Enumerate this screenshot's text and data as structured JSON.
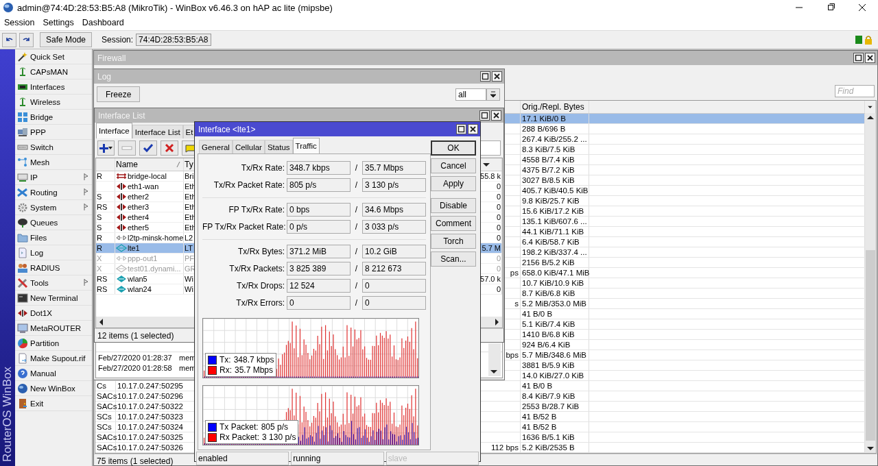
{
  "window": {
    "title": "admin@74:4D:28:53:B5:A8 (MikroTik) - WinBox v6.46.3 on hAP ac lite (mipsbe)"
  },
  "menu": [
    "Session",
    "Settings",
    "Dashboard"
  ],
  "toolbar": {
    "safe_mode": "Safe Mode",
    "session_label": "Session:",
    "session_value": "74:4D:28:53:B5:A8"
  },
  "sidebar": {
    "brand": "RouterOS WinBox",
    "items": [
      {
        "label": "Quick Set",
        "submenu": false
      },
      {
        "label": "CAPsMAN",
        "submenu": false
      },
      {
        "label": "Interfaces",
        "submenu": false
      },
      {
        "label": "Wireless",
        "submenu": false
      },
      {
        "label": "Bridge",
        "submenu": false
      },
      {
        "label": "PPP",
        "submenu": false
      },
      {
        "label": "Switch",
        "submenu": false
      },
      {
        "label": "Mesh",
        "submenu": false
      },
      {
        "label": "IP",
        "submenu": true
      },
      {
        "label": "Routing",
        "submenu": true
      },
      {
        "label": "System",
        "submenu": true
      },
      {
        "label": "Queues",
        "submenu": false
      },
      {
        "label": "Files",
        "submenu": false
      },
      {
        "label": "Log",
        "submenu": false
      },
      {
        "label": "RADIUS",
        "submenu": false
      },
      {
        "label": "Tools",
        "submenu": true
      },
      {
        "label": "New Terminal",
        "submenu": false
      },
      {
        "label": "Dot1X",
        "submenu": false
      },
      {
        "label": "MetaROUTER",
        "submenu": false
      },
      {
        "label": "Partition",
        "submenu": false
      },
      {
        "label": "Make Supout.rif",
        "submenu": false
      },
      {
        "label": "Manual",
        "submenu": false
      },
      {
        "label": "New WinBox",
        "submenu": false
      },
      {
        "label": "Exit",
        "submenu": false
      }
    ]
  },
  "firewall": {
    "title": "Firewall",
    "find_placeholder": "Find",
    "bytes_header": "Orig./Repl. Bytes",
    "status": "75 items (1 selected)",
    "rows": [
      {
        "bytes": "17.1 KiB/0 B",
        "selected": true
      },
      {
        "bytes": "288 B/696 B",
        "selected": false
      },
      {
        "bytes": "267.4 KiB/255.2 ...",
        "selected": false
      },
      {
        "bytes": "8.3 KiB/7.5 KiB",
        "selected": false
      },
      {
        "bytes": "4558 B/7.4 KiB",
        "selected": false
      },
      {
        "bytes": "4375 B/7.2 KiB",
        "selected": false
      },
      {
        "bytes": "3027 B/8.5 KiB",
        "selected": false
      },
      {
        "bytes": "405.7 KiB/40.5 KiB",
        "selected": false
      },
      {
        "bytes": "9.8 KiB/25.7 KiB",
        "selected": false
      },
      {
        "bytes": "15.6 KiB/17.2 KiB",
        "selected": false
      },
      {
        "bytes": "135.1 KiB/607.6 ...",
        "selected": false
      },
      {
        "bytes": "44.1 KiB/71.1 KiB",
        "selected": false
      },
      {
        "bytes": "6.4 KiB/58.7 KiB",
        "selected": false
      },
      {
        "bytes": "198.2 KiB/337.4 ...",
        "selected": false
      },
      {
        "bytes": "2156 B/5.2 KiB",
        "selected": false
      },
      {
        "rate": "ps",
        "bytes": "658.0 KiB/47.1 MiB",
        "selected": false
      },
      {
        "bytes": "10.7 KiB/10.9 KiB",
        "selected": false
      },
      {
        "bytes": "8.7 KiB/6.8 KiB",
        "selected": false
      },
      {
        "rate": "s",
        "bytes": "5.2 MiB/353.0 MiB",
        "selected": false
      },
      {
        "bytes": "41 B/0 B",
        "selected": false
      },
      {
        "bytes": "5.1 KiB/7.4 KiB",
        "selected": false
      },
      {
        "bytes": "1410 B/6.8 KiB",
        "selected": false
      },
      {
        "bytes": "924 B/6.4 KiB",
        "selected": false
      },
      {
        "rate": "bps",
        "bytes": "5.7 MiB/348.6 MiB",
        "selected": false
      },
      {
        "bytes": "3881 B/5.9 KiB",
        "selected": false
      },
      {
        "bytes": "14.0 KiB/27.0 KiB",
        "selected": false
      },
      {
        "flags": "Cs",
        "src": "10.17.0.247:50295",
        "bytes": "41 B/0 B",
        "selected": false
      },
      {
        "flags": "SACs",
        "src": "10.17.0.247:50296",
        "bytes": "8.4 KiB/7.9 KiB",
        "selected": false
      },
      {
        "flags": "SACs",
        "src": "10.17.0.247:50322",
        "bytes": "2553 B/28.7 KiB",
        "selected": false
      },
      {
        "flags": "SCs",
        "src": "10.17.0.247:50323",
        "bytes": "41 B/52 B",
        "selected": false
      },
      {
        "flags": "SCs",
        "src": "10.17.0.247:50324",
        "bytes": "41 B/52 B",
        "selected": false
      },
      {
        "flags": "SACs",
        "src": "10.17.0.247:50325",
        "bytes": "1636 B/5.1 KiB",
        "selected": false
      },
      {
        "flags": "SACs",
        "src": "10.17.0.247:50326",
        "rate": "112 bps",
        "bytes": "5.2 KiB/2535 B",
        "selected": false
      }
    ]
  },
  "log": {
    "title": "Log",
    "freeze": "Freeze",
    "topics": "all",
    "entries": [
      {
        "time": "Feb/27/2020 01:28:37",
        "message": "mem"
      },
      {
        "time": "Feb/27/2020 01:28:58",
        "message": "mem"
      }
    ]
  },
  "interface_list": {
    "title": "Interface List",
    "tabs": [
      {
        "label": "Interface",
        "selected": true
      },
      {
        "label": "Interface List",
        "selected": false
      },
      {
        "label": "Et",
        "selected": false
      }
    ],
    "name_header": "Name",
    "type_header": "Ty",
    "status": "12 items (1 selected)",
    "rows": [
      {
        "flags": "R",
        "kind": "bridge",
        "name": "bridge-local",
        "type": "Bri",
        "rx": "55.8 k",
        "selected": false,
        "disabled": false
      },
      {
        "kind": "ether",
        "name": "eth1-wan",
        "type": "Eth",
        "rx": "0",
        "selected": false,
        "disabled": false
      },
      {
        "flags": "S",
        "kind": "ether",
        "name": "ether2",
        "type": "Eth",
        "rx": "0",
        "selected": false,
        "disabled": false
      },
      {
        "flags": "RS",
        "kind": "ether",
        "name": "ether3",
        "type": "Eth",
        "rx": "0",
        "selected": false,
        "disabled": false
      },
      {
        "flags": "S",
        "kind": "ether",
        "name": "ether4",
        "type": "Eth",
        "rx": "0",
        "selected": false,
        "disabled": false
      },
      {
        "flags": "S",
        "kind": "ether",
        "name": "ether5",
        "type": "Eth",
        "rx": "0",
        "selected": false,
        "disabled": false
      },
      {
        "flags": "R",
        "kind": "tunnel",
        "name": "l2tp-minsk-home",
        "type": "L2",
        "rx": "0",
        "selected": false,
        "disabled": false
      },
      {
        "flags": "R",
        "kind": "lte",
        "name": "lte1",
        "type": "LT",
        "rx": "5.7 M",
        "selected": true,
        "disabled": false
      },
      {
        "flags": "X",
        "kind": "tunnel",
        "name": "ppp-out1",
        "type": "PF",
        "rx": "0",
        "selected": false,
        "disabled": true
      },
      {
        "flags": "X",
        "kind": "lte",
        "name": "test01.dynami...",
        "type": "GR",
        "rx": "0",
        "selected": false,
        "disabled": true
      },
      {
        "flags": "RS",
        "kind": "wlan",
        "name": "wlan5",
        "type": "Wi",
        "rx": "57.0 k",
        "selected": false,
        "disabled": false
      },
      {
        "flags": "RS",
        "kind": "wlan",
        "name": "wlan24",
        "type": "Wi",
        "rx": "0",
        "selected": false,
        "disabled": false
      }
    ]
  },
  "dialog": {
    "title": "Interface <lte1>",
    "tabs": [
      {
        "label": "General",
        "selected": false
      },
      {
        "label": "Cellular",
        "selected": false
      },
      {
        "label": "Status",
        "selected": false
      },
      {
        "label": "Traffic",
        "selected": true
      }
    ],
    "groups": [
      [
        {
          "label": "Tx/Rx Rate:",
          "tx": "348.7 kbps",
          "sep": "/",
          "rx": "35.7 Mbps"
        },
        {
          "label": "Tx/Rx Packet Rate:",
          "tx": "805 p/s",
          "sep": "/",
          "rx": "3 130 p/s"
        }
      ],
      [
        {
          "label": "FP Tx/Rx Rate:",
          "tx": "0 bps",
          "sep": "/",
          "rx": "34.6 Mbps"
        },
        {
          "label": "FP Tx/Rx Packet Rate:",
          "tx": "0 p/s",
          "sep": "/",
          "rx": "3 033 p/s"
        }
      ],
      [
        {
          "label": "Tx/Rx Bytes:",
          "tx": "371.2 MiB",
          "sep": "/",
          "rx": "10.2 GiB"
        },
        {
          "label": "Tx/Rx Packets:",
          "tx": "3 825 389",
          "sep": "/",
          "rx": "8 212 673"
        },
        {
          "label": "Tx/Rx Drops:",
          "tx": "12 524",
          "sep": "/",
          "rx": "0"
        },
        {
          "label": "Tx/Rx Errors:",
          "tx": "0",
          "sep": "/",
          "rx": "0"
        }
      ]
    ],
    "graphs": [
      {
        "legend": [
          {
            "label": "Tx:",
            "value": "348.7 kbps",
            "color": "#0000ff"
          },
          {
            "label": "Rx:",
            "value": "35.7 Mbps",
            "color": "#ff0000"
          }
        ]
      },
      {
        "legend": [
          {
            "label": "Tx Packet:",
            "value": "805 p/s",
            "color": "#0000ff"
          },
          {
            "label": "Rx Packet:",
            "value": "3 130 p/s",
            "color": "#ff0000"
          }
        ]
      }
    ],
    "buttons": [
      {
        "label": "OK",
        "default": true
      },
      {
        "label": "Cancel",
        "default": false
      },
      {
        "label": "Apply",
        "default": false
      },
      {
        "label": "Disable",
        "default": false
      },
      {
        "label": "Comment",
        "default": false
      },
      {
        "label": "Torch",
        "default": false
      },
      {
        "label": "Scan...",
        "default": false
      }
    ],
    "status": [
      {
        "text": "enabled",
        "active": true
      },
      {
        "text": "running",
        "active": true
      },
      {
        "text": "slave",
        "active": false
      }
    ]
  }
}
